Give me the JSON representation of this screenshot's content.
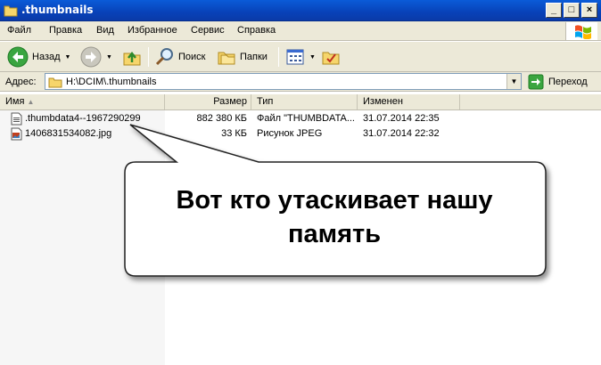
{
  "window": {
    "title": ".thumbnails",
    "min": "_",
    "max": "□",
    "close": "×"
  },
  "menu": [
    "Файл",
    "Правка",
    "Вид",
    "Избранное",
    "Сервис",
    "Справка"
  ],
  "toolbar": {
    "back": "Назад",
    "search": "Поиск",
    "folders": "Папки"
  },
  "address": {
    "label": "Адрес:",
    "path": "H:\\DCIM\\.thumbnails",
    "go": "Переход"
  },
  "columns": [
    "Имя",
    "Размер",
    "Тип",
    "Изменен"
  ],
  "files": [
    {
      "name": ".thumbdata4--1967290299",
      "size": "882 380 КБ",
      "type": "Файл \"THUMBDATA...",
      "modified": "31.07.2014 22:35"
    },
    {
      "name": "1406831534082.jpg",
      "size": "33 КБ",
      "type": "Рисунок JPEG",
      "modified": "31.07.2014 22:32"
    }
  ],
  "callout": {
    "line1": "Вот кто утаскивает нашу",
    "line2": "память"
  }
}
